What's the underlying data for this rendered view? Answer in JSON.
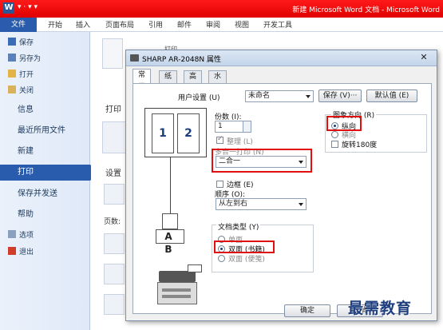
{
  "window": {
    "title": "新建 Microsoft Word 文档 - Microsoft Word",
    "qat": "▾ · ▾ ▾"
  },
  "ribbon_tabs": [
    "文件",
    "开始",
    "插入",
    "页面布局",
    "引用",
    "邮件",
    "审阅",
    "视图",
    "开发工具"
  ],
  "sidebar": {
    "items": [
      {
        "label": "保存",
        "icon": "save-icon"
      },
      {
        "label": "另存为",
        "icon": "save-as-icon"
      },
      {
        "label": "打开",
        "icon": "folder-open-icon"
      },
      {
        "label": "关闭",
        "icon": "close-file-icon"
      },
      {
        "label": "信息"
      },
      {
        "label": "最近所用文件"
      },
      {
        "label": "新建"
      },
      {
        "label": "打印"
      },
      {
        "label": "保存并发送"
      },
      {
        "label": "帮助"
      },
      {
        "label": "选项",
        "icon": "options-icon"
      },
      {
        "label": "退出",
        "icon": "exit-icon"
      }
    ]
  },
  "backstage": {
    "print_heading": "打印",
    "settings_heading": "设置",
    "pages_label": "页数:",
    "top_label": "打印"
  },
  "dialog": {
    "title": "SHARP AR-2048N 属性",
    "close": "✕",
    "tabs": [
      "常用",
      "纸张",
      "高级",
      "水印"
    ],
    "user_settings_label": "用户设置 (U)",
    "user_settings_value": "未命名",
    "save_button": "保存 (V)···",
    "default_button": "默认值 (E)",
    "copies_label": "份数 (I):",
    "copies_value": "1",
    "collate_label": "整理 (L)",
    "multipage_label": "多合一打印 (N)",
    "multipage_value": "二合一",
    "border_label": "边框 (E)",
    "order_label": "顺序 (O):",
    "order_value": "从左到右",
    "doc_type_label": "文档类型 (Y)",
    "doc_types": [
      "单面",
      "双面 (书籍)",
      "双面 (便笺)"
    ],
    "orientation_label": "图象方向 (R)",
    "orientations": [
      "纵向",
      "横向"
    ],
    "rotate_label": "旋转180度",
    "preview_pages": [
      "1",
      "2"
    ],
    "ab_label": "A B",
    "ok_button": "确定",
    "cancel_button": "取消"
  },
  "watermark_text": "最需教育"
}
